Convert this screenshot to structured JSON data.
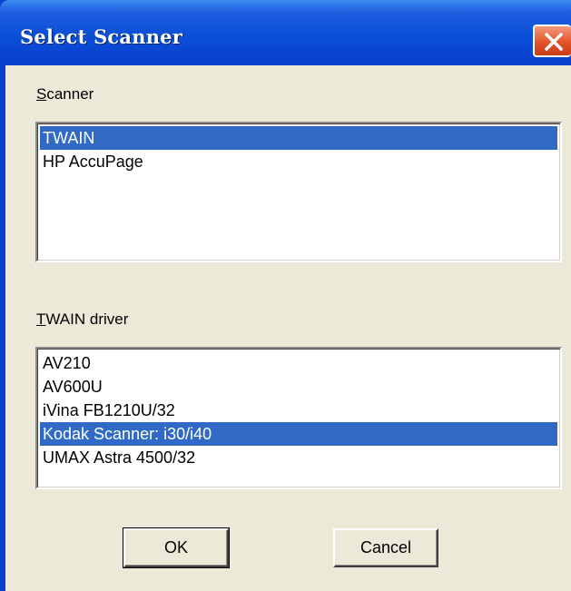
{
  "window": {
    "title": "Select Scanner",
    "close_icon": "close-icon"
  },
  "scanner": {
    "label_mnemonic": "S",
    "label_rest": "canner",
    "items": [
      {
        "label": "TWAIN",
        "selected": true
      },
      {
        "label": "HP AccuPage",
        "selected": false
      }
    ]
  },
  "twain_driver": {
    "label_mnemonic": "T",
    "label_rest": "WAIN driver",
    "items": [
      {
        "label": "AV210",
        "selected": false
      },
      {
        "label": "AV600U",
        "selected": false
      },
      {
        "label": "iVina FB1210U/32",
        "selected": false
      },
      {
        "label": "Kodak Scanner: i30/i40",
        "selected": true
      },
      {
        "label": "UMAX Astra 4500/32",
        "selected": false
      }
    ]
  },
  "buttons": {
    "ok_label": "OK",
    "cancel_label": "Cancel"
  },
  "colors": {
    "titlebar": "#0a3fcf",
    "selection": "#316ac5",
    "dialog_bg": "#ece9d8",
    "close_button": "#e4532a"
  }
}
